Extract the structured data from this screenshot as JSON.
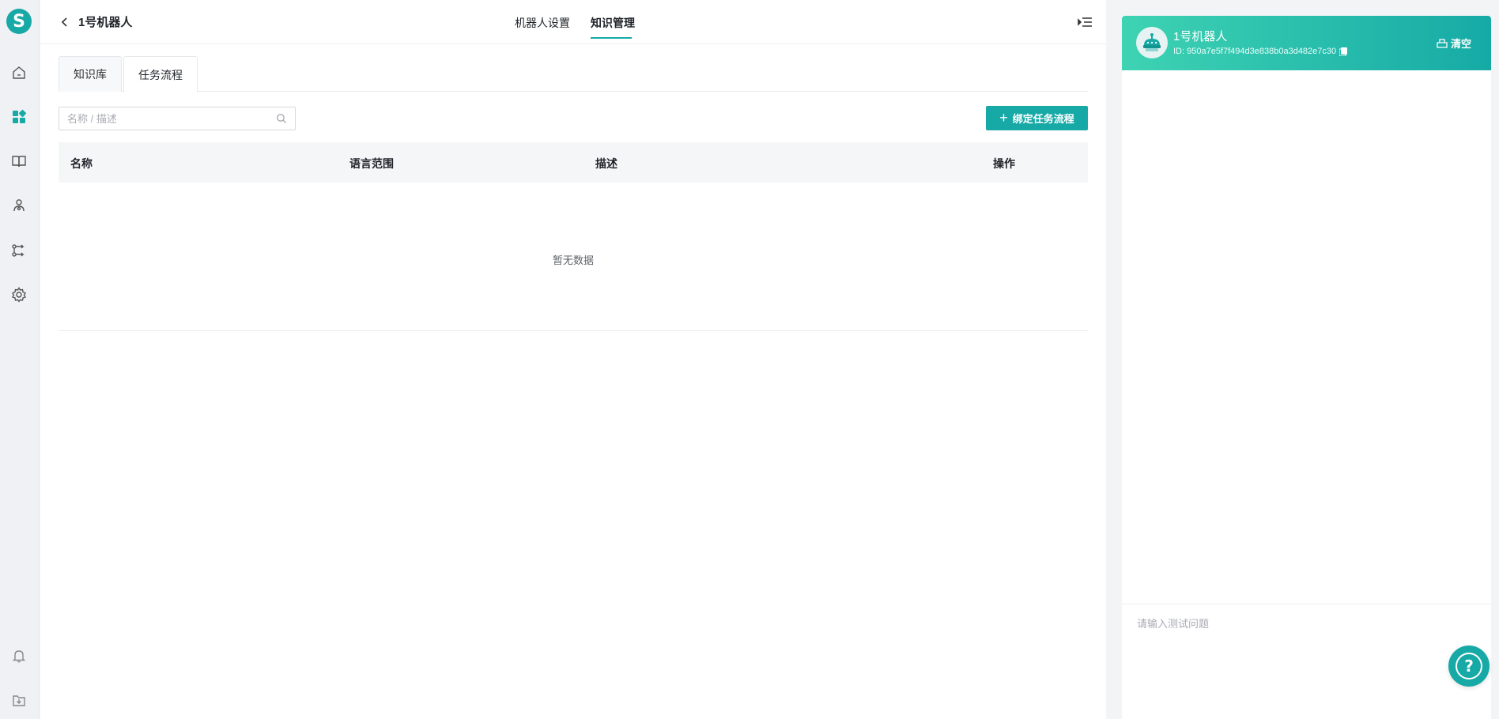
{
  "sidebar": {
    "logo_letter": "S",
    "icons": [
      "home-icon",
      "apps-icon",
      "book-icon",
      "users-icon",
      "flow-icon",
      "settings-icon",
      "bell-icon",
      "download-icon"
    ],
    "active_icon": "apps-icon",
    "accent_color": "#16a9a6"
  },
  "header": {
    "title": "1号机器人",
    "tabs": [
      {
        "label": "机器人设置",
        "active": false
      },
      {
        "label": "知识管理",
        "active": true
      }
    ]
  },
  "subtabs": [
    {
      "label": "知识库",
      "active": false
    },
    {
      "label": "任务流程",
      "active": true
    }
  ],
  "search": {
    "placeholder": "名称 / 描述",
    "value": ""
  },
  "toolbar": {
    "bind_label": "绑定任务流程"
  },
  "table": {
    "columns": [
      "名称",
      "语言范围",
      "描述",
      "操作"
    ],
    "rows": [],
    "empty_text": "暂无数据"
  },
  "chat": {
    "bot_name": "1号机器人",
    "bot_id": "ID: 950a7e5f7f494d3e838b0a3d482e7c30",
    "clear_label": "清空",
    "input_placeholder": "请输入测试问题",
    "header_gradient": [
      "#3ed3b3",
      "#16aaa6"
    ]
  },
  "help": {
    "symbol": "?"
  }
}
